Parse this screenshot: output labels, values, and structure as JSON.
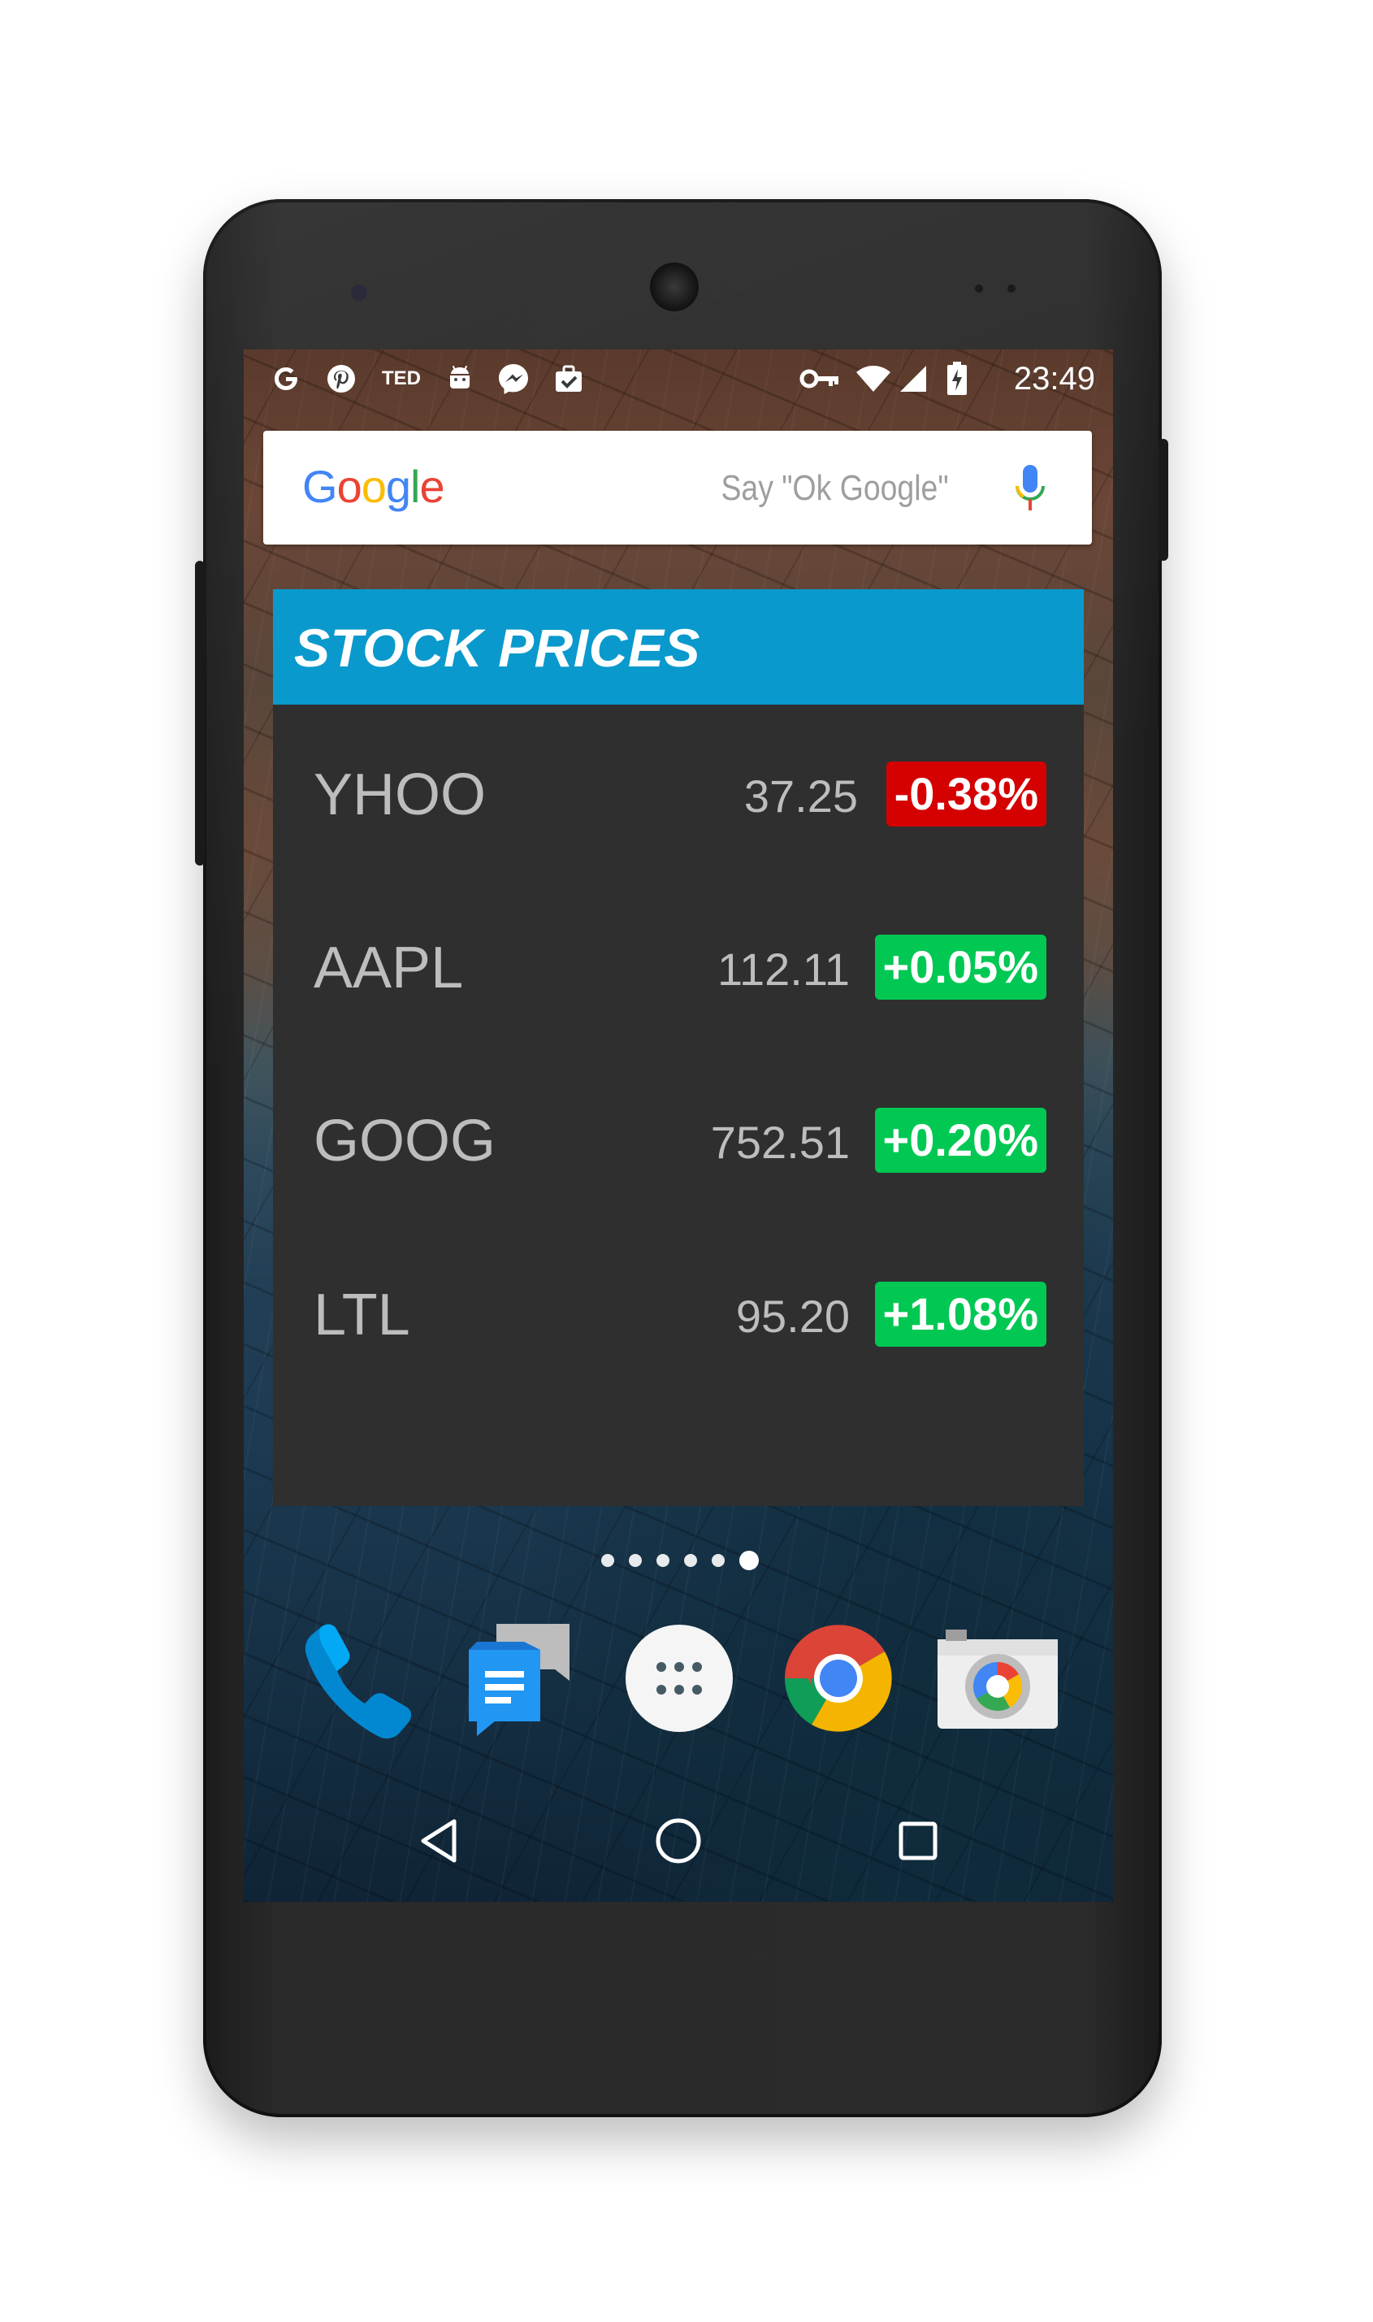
{
  "statusbar": {
    "time": "23:49",
    "notification_icons": [
      "google-icon",
      "pinterest-icon",
      "ted-icon",
      "android-icon",
      "messenger-icon",
      "briefcase-check-icon"
    ],
    "ted_label": "TED",
    "system_icons": [
      "vpn-key-icon",
      "wifi-icon",
      "cell-signal-icon",
      "battery-charging-icon"
    ]
  },
  "search": {
    "logo_letters": [
      "G",
      "o",
      "o",
      "g",
      "l",
      "e"
    ],
    "hint": "Say \"Ok Google\""
  },
  "widget": {
    "title": "STOCK PRICES",
    "colors": {
      "header": "#0a99cc",
      "body": "#2f2f2f",
      "down": "#d50000",
      "up": "#00c853"
    },
    "stocks": [
      {
        "symbol": "YHOO",
        "price": "37.25",
        "change": "-0.38%",
        "direction": "down"
      },
      {
        "symbol": "AAPL",
        "price": "112.11",
        "change": "+0.05%",
        "direction": "up"
      },
      {
        "symbol": "GOOG",
        "price": "752.51",
        "change": "+0.20%",
        "direction": "up"
      },
      {
        "symbol": "LTL",
        "price": "95.20",
        "change": "+1.08%",
        "direction": "up"
      }
    ]
  },
  "home": {
    "page_count": 6,
    "active_page": 6
  },
  "dock": {
    "apps": [
      "phone-icon",
      "messenger-sms-icon",
      "app-drawer-icon",
      "chrome-icon",
      "camera-icon"
    ]
  },
  "navigation": {
    "buttons": [
      "back-icon",
      "home-icon",
      "recents-icon"
    ]
  }
}
